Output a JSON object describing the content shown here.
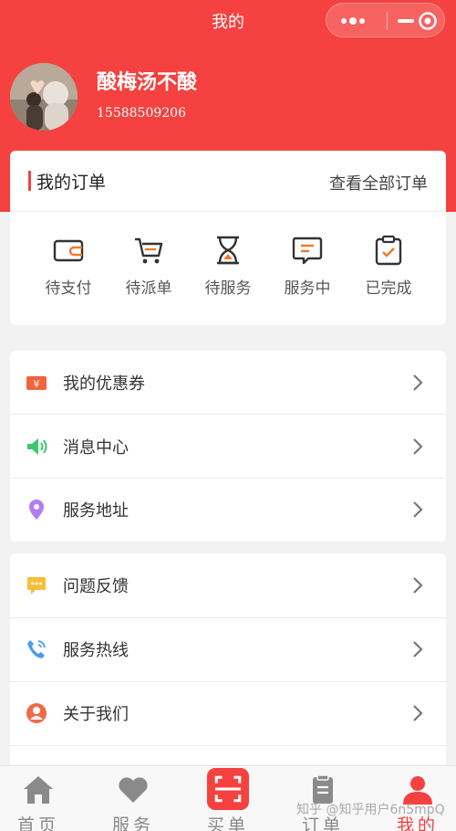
{
  "header": {
    "title": "我的"
  },
  "profile": {
    "nickname": "酸梅汤不酸",
    "phone": "15588509206"
  },
  "orders": {
    "title": "我的订单",
    "view_all": "查看全部订单",
    "statuses": [
      {
        "label": "待支付",
        "icon": "wallet-icon"
      },
      {
        "label": "待派单",
        "icon": "cart-icon"
      },
      {
        "label": "待服务",
        "icon": "hourglass-icon"
      },
      {
        "label": "服务中",
        "icon": "message-icon"
      },
      {
        "label": "已完成",
        "icon": "clipboard-check-icon"
      }
    ]
  },
  "menu_group_1": [
    {
      "label": "我的优惠券",
      "icon": "coupon-icon"
    },
    {
      "label": "消息中心",
      "icon": "speaker-icon"
    },
    {
      "label": "服务地址",
      "icon": "location-pin-icon"
    }
  ],
  "menu_group_2": [
    {
      "label": "问题反馈",
      "icon": "feedback-icon"
    },
    {
      "label": "服务热线",
      "icon": "phone-icon"
    },
    {
      "label": "关于我们",
      "icon": "user-circle-icon"
    }
  ],
  "tabbar": [
    {
      "label": "首页",
      "icon": "home-icon"
    },
    {
      "label": "服务",
      "icon": "heart-icon"
    },
    {
      "label": "买单",
      "icon": "scan-icon"
    },
    {
      "label": "订单",
      "icon": "order-icon"
    },
    {
      "label": "我的",
      "icon": "user-icon",
      "active": true
    }
  ],
  "watermark": "知乎 @知乎用户6n5mpQ",
  "colors": {
    "brand": "#f5413f",
    "accent_orange": "#f07a2e"
  }
}
